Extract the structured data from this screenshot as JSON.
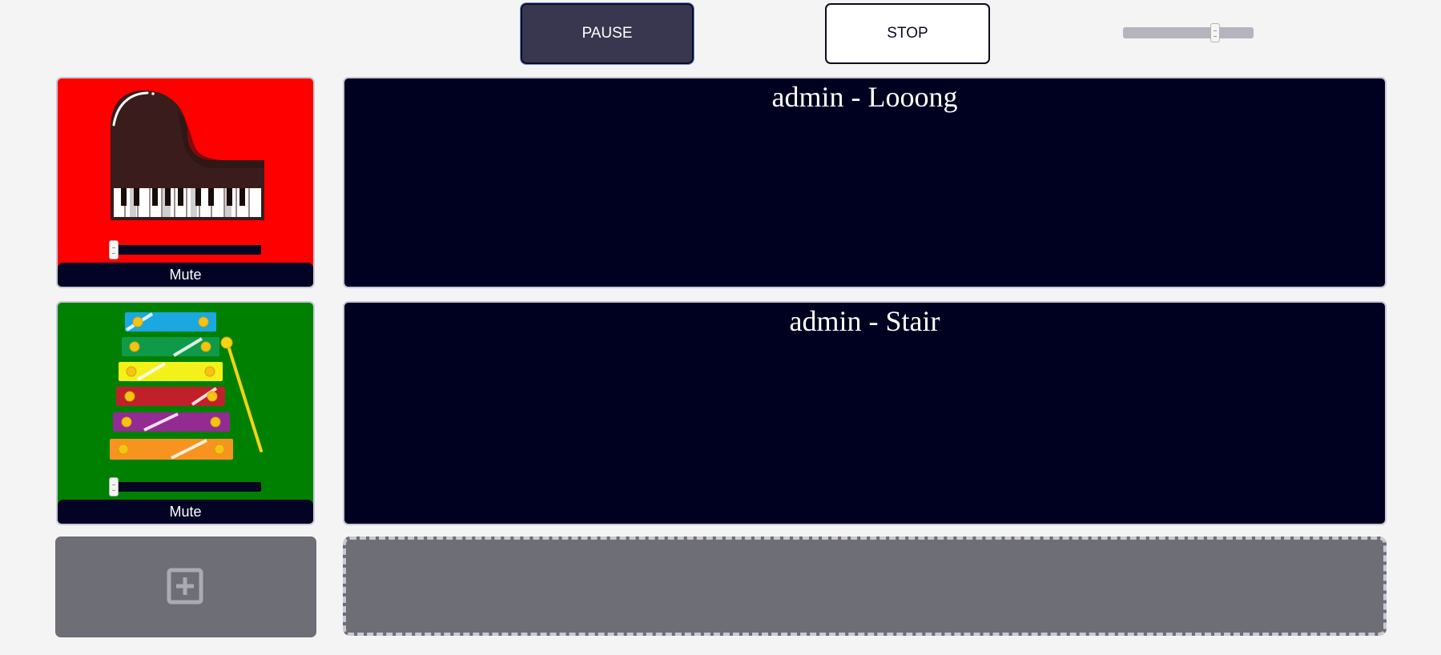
{
  "controls": {
    "pause_label": "PAUSE",
    "stop_label": "STOP",
    "master_volume_fraction": 0.72
  },
  "instruments": [
    {
      "name": "piano",
      "background": "#ff0000",
      "mute_label": "Mute",
      "volume_fraction": 0.0
    },
    {
      "name": "xylophone",
      "background": "#008000",
      "mute_label": "Mute",
      "volume_fraction": 0.0
    }
  ],
  "tracks": [
    {
      "title": "admin - Looong"
    },
    {
      "title": "admin - Stair"
    }
  ],
  "add_instrument": {
    "icon": "plus-square-icon"
  },
  "colors": {
    "page_background": "#f4f4f4",
    "button_dark": "#38374f",
    "track_background": "#000020",
    "placeholder_gray": "#6d6e76"
  }
}
